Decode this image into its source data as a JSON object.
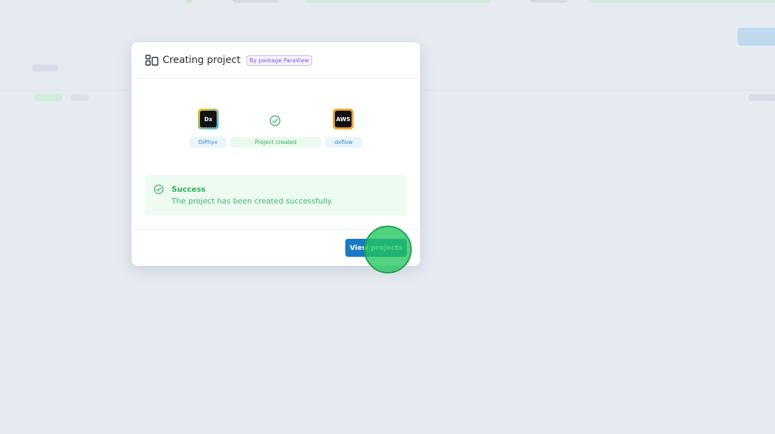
{
  "modal": {
    "title": "Creating project",
    "tag": "By package ParaView"
  },
  "flow": {
    "source": {
      "logo": "Dx",
      "label": "DiPhyx"
    },
    "middle": {
      "label": "Project created"
    },
    "target": {
      "logo": "AWS",
      "label": "dxflow"
    }
  },
  "alert": {
    "title": "Success",
    "message": "The project has been created successfully."
  },
  "footer": {
    "primary_button": "View projects"
  },
  "colors": {
    "accent": "#1a79c4",
    "success": "#2fae56",
    "tag": "#7c4fd6"
  },
  "icons": {
    "header": "project-layout-icon",
    "middle": "check-circle-icon",
    "alert": "check-circle-icon"
  }
}
